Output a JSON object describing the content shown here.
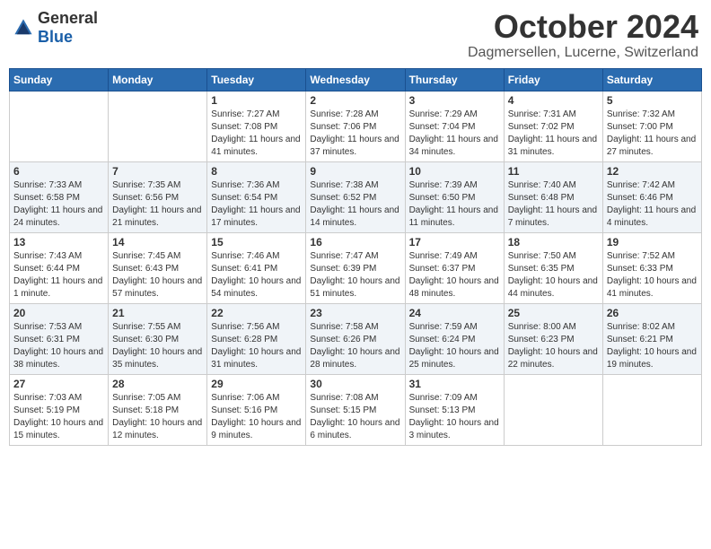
{
  "header": {
    "logo_general": "General",
    "logo_blue": "Blue",
    "month_title": "October 2024",
    "location": "Dagmersellen, Lucerne, Switzerland"
  },
  "weekdays": [
    "Sunday",
    "Monday",
    "Tuesday",
    "Wednesday",
    "Thursday",
    "Friday",
    "Saturday"
  ],
  "weeks": [
    [
      {
        "day": "",
        "info": ""
      },
      {
        "day": "",
        "info": ""
      },
      {
        "day": "1",
        "info": "Sunrise: 7:27 AM\nSunset: 7:08 PM\nDaylight: 11 hours and 41 minutes."
      },
      {
        "day": "2",
        "info": "Sunrise: 7:28 AM\nSunset: 7:06 PM\nDaylight: 11 hours and 37 minutes."
      },
      {
        "day": "3",
        "info": "Sunrise: 7:29 AM\nSunset: 7:04 PM\nDaylight: 11 hours and 34 minutes."
      },
      {
        "day": "4",
        "info": "Sunrise: 7:31 AM\nSunset: 7:02 PM\nDaylight: 11 hours and 31 minutes."
      },
      {
        "day": "5",
        "info": "Sunrise: 7:32 AM\nSunset: 7:00 PM\nDaylight: 11 hours and 27 minutes."
      }
    ],
    [
      {
        "day": "6",
        "info": "Sunrise: 7:33 AM\nSunset: 6:58 PM\nDaylight: 11 hours and 24 minutes."
      },
      {
        "day": "7",
        "info": "Sunrise: 7:35 AM\nSunset: 6:56 PM\nDaylight: 11 hours and 21 minutes."
      },
      {
        "day": "8",
        "info": "Sunrise: 7:36 AM\nSunset: 6:54 PM\nDaylight: 11 hours and 17 minutes."
      },
      {
        "day": "9",
        "info": "Sunrise: 7:38 AM\nSunset: 6:52 PM\nDaylight: 11 hours and 14 minutes."
      },
      {
        "day": "10",
        "info": "Sunrise: 7:39 AM\nSunset: 6:50 PM\nDaylight: 11 hours and 11 minutes."
      },
      {
        "day": "11",
        "info": "Sunrise: 7:40 AM\nSunset: 6:48 PM\nDaylight: 11 hours and 7 minutes."
      },
      {
        "day": "12",
        "info": "Sunrise: 7:42 AM\nSunset: 6:46 PM\nDaylight: 11 hours and 4 minutes."
      }
    ],
    [
      {
        "day": "13",
        "info": "Sunrise: 7:43 AM\nSunset: 6:44 PM\nDaylight: 11 hours and 1 minute."
      },
      {
        "day": "14",
        "info": "Sunrise: 7:45 AM\nSunset: 6:43 PM\nDaylight: 10 hours and 57 minutes."
      },
      {
        "day": "15",
        "info": "Sunrise: 7:46 AM\nSunset: 6:41 PM\nDaylight: 10 hours and 54 minutes."
      },
      {
        "day": "16",
        "info": "Sunrise: 7:47 AM\nSunset: 6:39 PM\nDaylight: 10 hours and 51 minutes."
      },
      {
        "day": "17",
        "info": "Sunrise: 7:49 AM\nSunset: 6:37 PM\nDaylight: 10 hours and 48 minutes."
      },
      {
        "day": "18",
        "info": "Sunrise: 7:50 AM\nSunset: 6:35 PM\nDaylight: 10 hours and 44 minutes."
      },
      {
        "day": "19",
        "info": "Sunrise: 7:52 AM\nSunset: 6:33 PM\nDaylight: 10 hours and 41 minutes."
      }
    ],
    [
      {
        "day": "20",
        "info": "Sunrise: 7:53 AM\nSunset: 6:31 PM\nDaylight: 10 hours and 38 minutes."
      },
      {
        "day": "21",
        "info": "Sunrise: 7:55 AM\nSunset: 6:30 PM\nDaylight: 10 hours and 35 minutes."
      },
      {
        "day": "22",
        "info": "Sunrise: 7:56 AM\nSunset: 6:28 PM\nDaylight: 10 hours and 31 minutes."
      },
      {
        "day": "23",
        "info": "Sunrise: 7:58 AM\nSunset: 6:26 PM\nDaylight: 10 hours and 28 minutes."
      },
      {
        "day": "24",
        "info": "Sunrise: 7:59 AM\nSunset: 6:24 PM\nDaylight: 10 hours and 25 minutes."
      },
      {
        "day": "25",
        "info": "Sunrise: 8:00 AM\nSunset: 6:23 PM\nDaylight: 10 hours and 22 minutes."
      },
      {
        "day": "26",
        "info": "Sunrise: 8:02 AM\nSunset: 6:21 PM\nDaylight: 10 hours and 19 minutes."
      }
    ],
    [
      {
        "day": "27",
        "info": "Sunrise: 7:03 AM\nSunset: 5:19 PM\nDaylight: 10 hours and 15 minutes."
      },
      {
        "day": "28",
        "info": "Sunrise: 7:05 AM\nSunset: 5:18 PM\nDaylight: 10 hours and 12 minutes."
      },
      {
        "day": "29",
        "info": "Sunrise: 7:06 AM\nSunset: 5:16 PM\nDaylight: 10 hours and 9 minutes."
      },
      {
        "day": "30",
        "info": "Sunrise: 7:08 AM\nSunset: 5:15 PM\nDaylight: 10 hours and 6 minutes."
      },
      {
        "day": "31",
        "info": "Sunrise: 7:09 AM\nSunset: 5:13 PM\nDaylight: 10 hours and 3 minutes."
      },
      {
        "day": "",
        "info": ""
      },
      {
        "day": "",
        "info": ""
      }
    ]
  ]
}
